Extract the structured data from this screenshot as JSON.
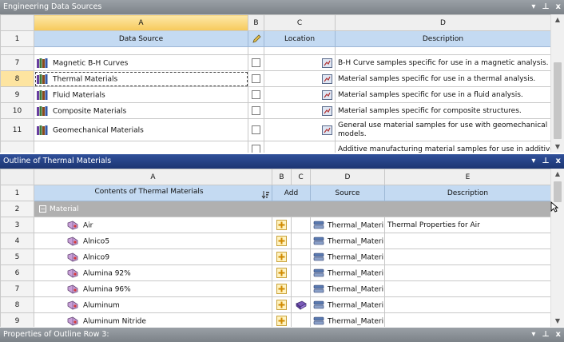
{
  "eds": {
    "title": "Engineering Data Sources",
    "columns": [
      "A",
      "B",
      "C",
      "D"
    ],
    "headers": {
      "a": "Data Source",
      "c": "Location",
      "d": "Description"
    },
    "row1": "1",
    "rows": [
      {
        "n": "7",
        "name": "Magnetic B-H Curves",
        "desc": "B-H Curve samples specific for use in a magnetic analysis."
      },
      {
        "n": "8",
        "name": "Thermal Materials",
        "desc": "Material samples specific for use in a thermal analysis."
      },
      {
        "n": "9",
        "name": "Fluid Materials",
        "desc": "Material samples specific for use in a fluid analysis."
      },
      {
        "n": "10",
        "name": "Composite Materials",
        "desc": "Material samples specific for composite structures."
      },
      {
        "n": "11",
        "name": "Geomechanical Materials",
        "desc": "General use material samples for use with geomechanical models."
      }
    ],
    "partial_desc": "Additive manufacturing material samples for use in additive"
  },
  "outline": {
    "title": "Outline of Thermal Materials",
    "columns": [
      "A",
      "B",
      "C",
      "D",
      "E"
    ],
    "headers": {
      "a": "Contents of Thermal Materials",
      "add": "Add",
      "source": "Source",
      "desc": "Description"
    },
    "row1": "1",
    "group": {
      "n": "2",
      "label": "Material",
      "expander": "−"
    },
    "rows": [
      {
        "n": "3",
        "name": "Air",
        "source": "Thermal_Materi",
        "desc": "Thermal Properties for Air"
      },
      {
        "n": "4",
        "name": "Alnico5",
        "source": "Thermal_Materi",
        "desc": ""
      },
      {
        "n": "5",
        "name": "Alnico9",
        "source": "Thermal_Materi",
        "desc": ""
      },
      {
        "n": "6",
        "name": "Alumina 92%",
        "source": "Thermal_Materi",
        "desc": ""
      },
      {
        "n": "7",
        "name": "Alumina 96%",
        "source": "Thermal_Materi",
        "desc": ""
      },
      {
        "n": "8",
        "name": "Aluminum",
        "source": "Thermal_Materi",
        "desc": ""
      },
      {
        "n": "9",
        "name": "Aluminum Nitride",
        "source": "Thermal_Materi",
        "desc": ""
      }
    ]
  },
  "props": {
    "title": "Properties of Outline Row 3:"
  },
  "controls": {
    "dropdown": "▾",
    "pin": "⊥",
    "close": "x"
  },
  "scroll": {
    "up": "▲",
    "down": "▼"
  },
  "icons": {
    "books": "library-books-icon",
    "location": "location-icon",
    "material": "material-icon",
    "add": "plus-icon",
    "source": "library-icon",
    "sort": "sort-icon",
    "pencil": "pencil-icon",
    "book": "book-icon"
  }
}
